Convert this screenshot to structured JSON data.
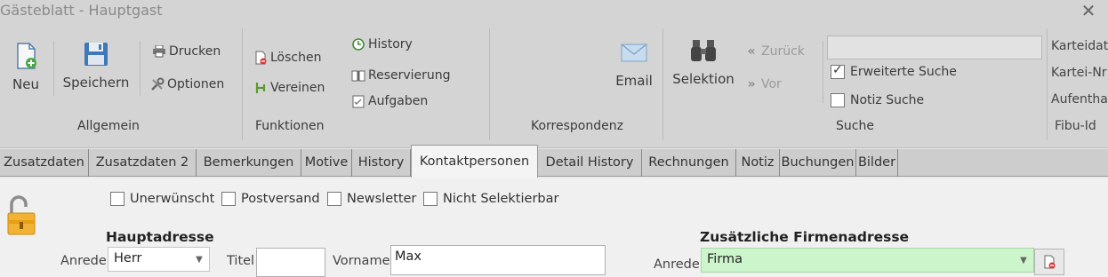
{
  "window": {
    "title": "Gästeblatt - Hauptgast"
  },
  "ribbon": {
    "allgemein": {
      "label": "Allgemein",
      "neu": "Neu",
      "speichern": "Speichern",
      "drucken": "Drucken",
      "optionen": "Optionen"
    },
    "funktionen": {
      "label": "Funktionen",
      "loeschen": "Löschen",
      "vereinen": "Vereinen",
      "history": "History",
      "reservierung": "Reservierung",
      "aufgaben": "Aufgaben"
    },
    "korrespondenz": {
      "label": "Korrespondenz",
      "email": "Email"
    },
    "suche": {
      "label": "Suche",
      "selektion": "Selektion",
      "zurueck": "Zurück",
      "vor": "Vor",
      "search_value": "",
      "erweiterte_suche": "Erweiterte Suche",
      "notiz_suche": "Notiz Suche"
    },
    "kartei": {
      "items": [
        "Karteidatu",
        "Kartei-Nr",
        "Aufentha",
        "Fibu-Id"
      ]
    }
  },
  "tabs": [
    "Zusatzdaten",
    "Zusatzdaten 2",
    "Bemerkungen",
    "Motive",
    "History",
    "Kontaktpersonen",
    "Detail History",
    "Rechnungen",
    "Notiz",
    "Buchungen",
    "Bilder"
  ],
  "active_tab": "Kontaktpersonen",
  "form": {
    "checkboxes": {
      "unerwuenscht": "Unerwünscht",
      "postversand": "Postversand",
      "newsletter": "Newsletter",
      "nicht_selektierbar": "Nicht Selektierbar"
    },
    "hauptadresse": {
      "header": "Hauptadresse",
      "anrede_label": "Anrede",
      "anrede_value": "Herr",
      "titel_label": "Titel",
      "titel_value": "",
      "vorname_label": "Vorname",
      "vorname_value": "Max"
    },
    "firmenadresse": {
      "header": "Zusätzliche Firmenadresse",
      "anrede_label": "Anrede",
      "anrede_value": "Firma"
    }
  }
}
